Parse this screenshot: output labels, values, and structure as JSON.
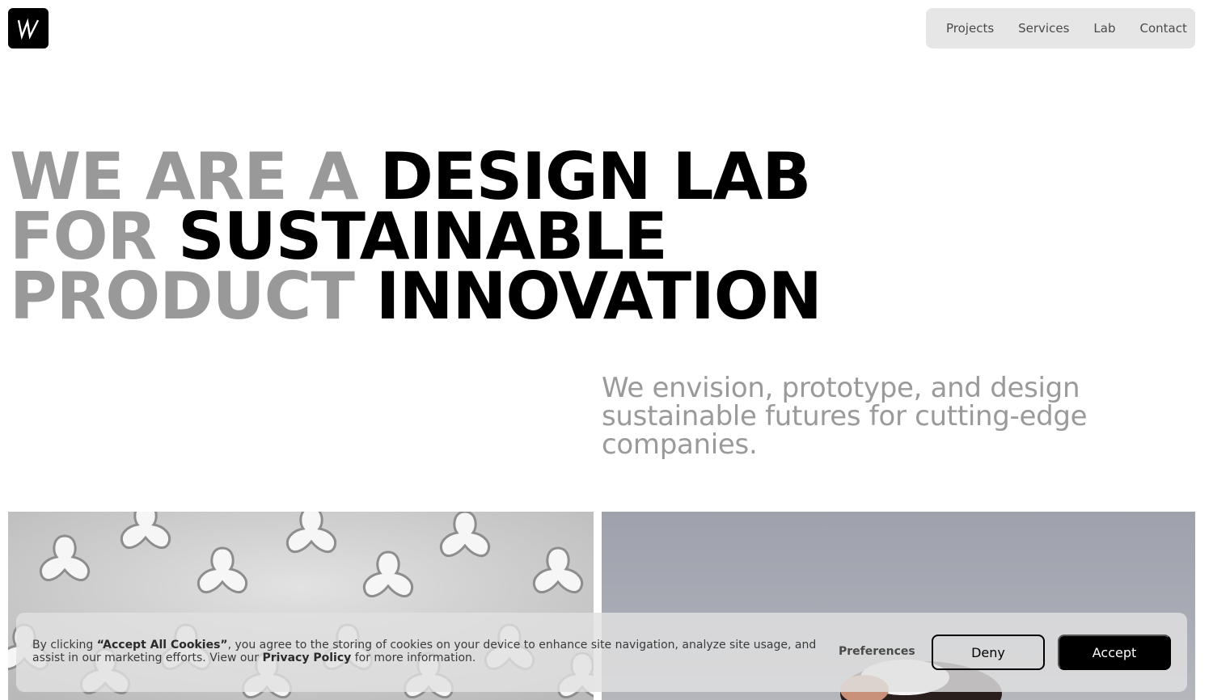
{
  "logo": {
    "text": "W",
    "icon": "w-logo-icon"
  },
  "nav": {
    "items": [
      {
        "label": "Projects"
      },
      {
        "label": "Services"
      },
      {
        "label": "Lab"
      },
      {
        "label": "Contact"
      }
    ]
  },
  "hero": {
    "line1_muted": "WE ARE A",
    "line1_strong": "DESIGN LAB",
    "line2_muted": "FOR",
    "line2_strong": "SUSTAINABLE",
    "line3_muted": "PRODUCT",
    "line3_strong": "INNOVATION"
  },
  "subtext": "We envision, prototype, and design sustainable futures for cutting-edge companies.",
  "images": {
    "left": "white trefoil pattern photo",
    "right": "hand holding object on grey background"
  },
  "cookie": {
    "text_prefix": "By clicking ",
    "text_bold1": "“Accept All Cookies”",
    "text_mid": ", you agree to the storing of cookies on your device to enhance site navigation, analyze site usage, and assist in our marketing efforts. View our ",
    "text_bold2": "Privacy Policy",
    "text_suffix": " for more information.",
    "preferences_label": "Preferences",
    "deny_label": "Deny",
    "accept_label": "Accept"
  },
  "colors": {
    "muted_heading": "#999999",
    "strong_heading": "#000000",
    "nav_bg": "#e6e6e6",
    "accept_bg": "#000000"
  }
}
